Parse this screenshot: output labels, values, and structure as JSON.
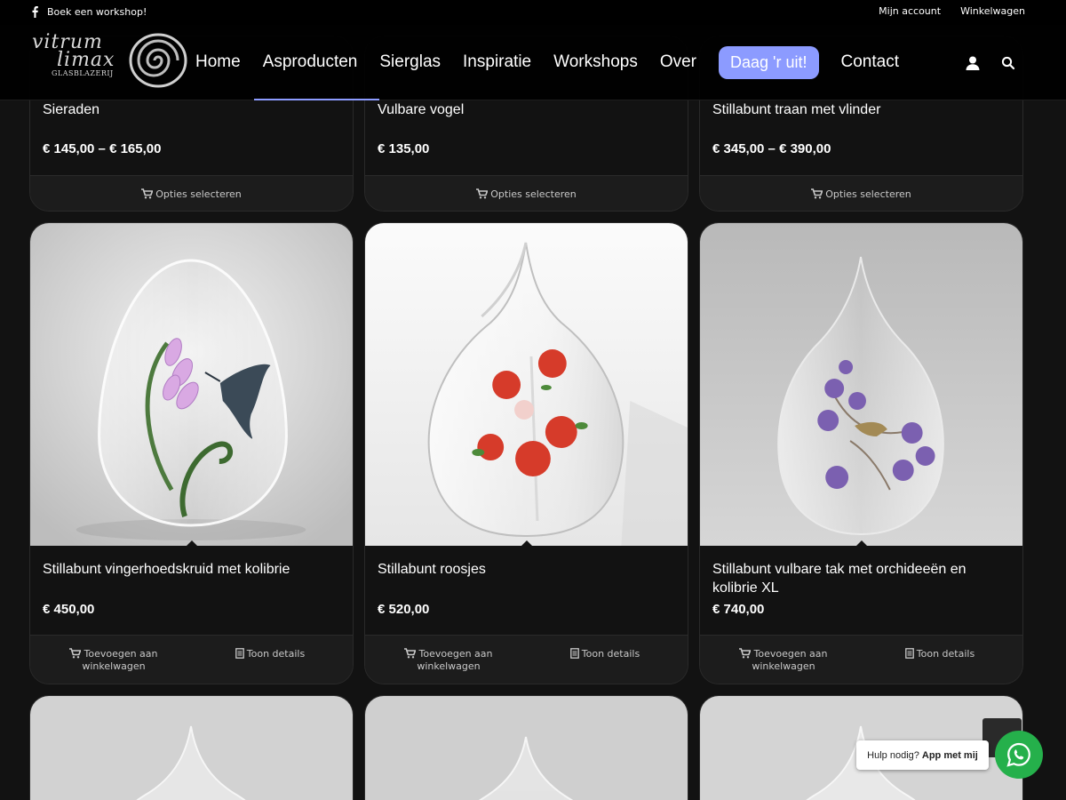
{
  "topbar": {
    "left_link": "Boek een workshop!",
    "right_links": [
      "Mijn account",
      "Winkelwagen"
    ]
  },
  "header": {
    "logo": {
      "line1": "vitrum",
      "line2": "limax",
      "line3": "GLASBLAZERIJ"
    },
    "nav": [
      {
        "label": "Home"
      },
      {
        "label": "Asproducten",
        "active": true
      },
      {
        "label": "Sierglas"
      },
      {
        "label": "Inspiratie"
      },
      {
        "label": "Workshops"
      },
      {
        "label": "Over"
      },
      {
        "label": "Daag 'r uit!",
        "highlight": true
      },
      {
        "label": "Contact"
      }
    ],
    "icons": [
      "user-icon",
      "search-icon"
    ],
    "accent_color": "#8c9bff"
  },
  "products_top_row": [
    {
      "title": "Sieraden",
      "price": "€ 145,00 – € 165,00",
      "action": "Opties selecteren"
    },
    {
      "title": "Vulbare vogel",
      "price": "€ 135,00",
      "action": "Opties selecteren"
    },
    {
      "title": "Stillabunt traan met vlinder",
      "price": "€ 345,00 – € 390,00",
      "action": "Opties selecteren"
    }
  ],
  "products_middle_row": [
    {
      "title": "Stillabunt vingerhoedskruid met kolibrie",
      "price": "€ 450,00",
      "add_label": "Toevoegen aan winkelwagen",
      "details_label": "Toon details"
    },
    {
      "title": "Stillabunt roosjes",
      "price": "€ 520,00",
      "add_label": "Toevoegen aan winkelwagen",
      "details_label": "Toon details"
    },
    {
      "title": "Stillabunt vulbare tak met orchideeën en kolibrie XL",
      "price": "€ 740,00",
      "add_label": "Toevoegen aan winkelwagen",
      "details_label": "Toon details"
    }
  ],
  "help": {
    "text": "Hulp nodig?",
    "bold": "App met mij"
  },
  "whatsapp_color": "#25b04b"
}
